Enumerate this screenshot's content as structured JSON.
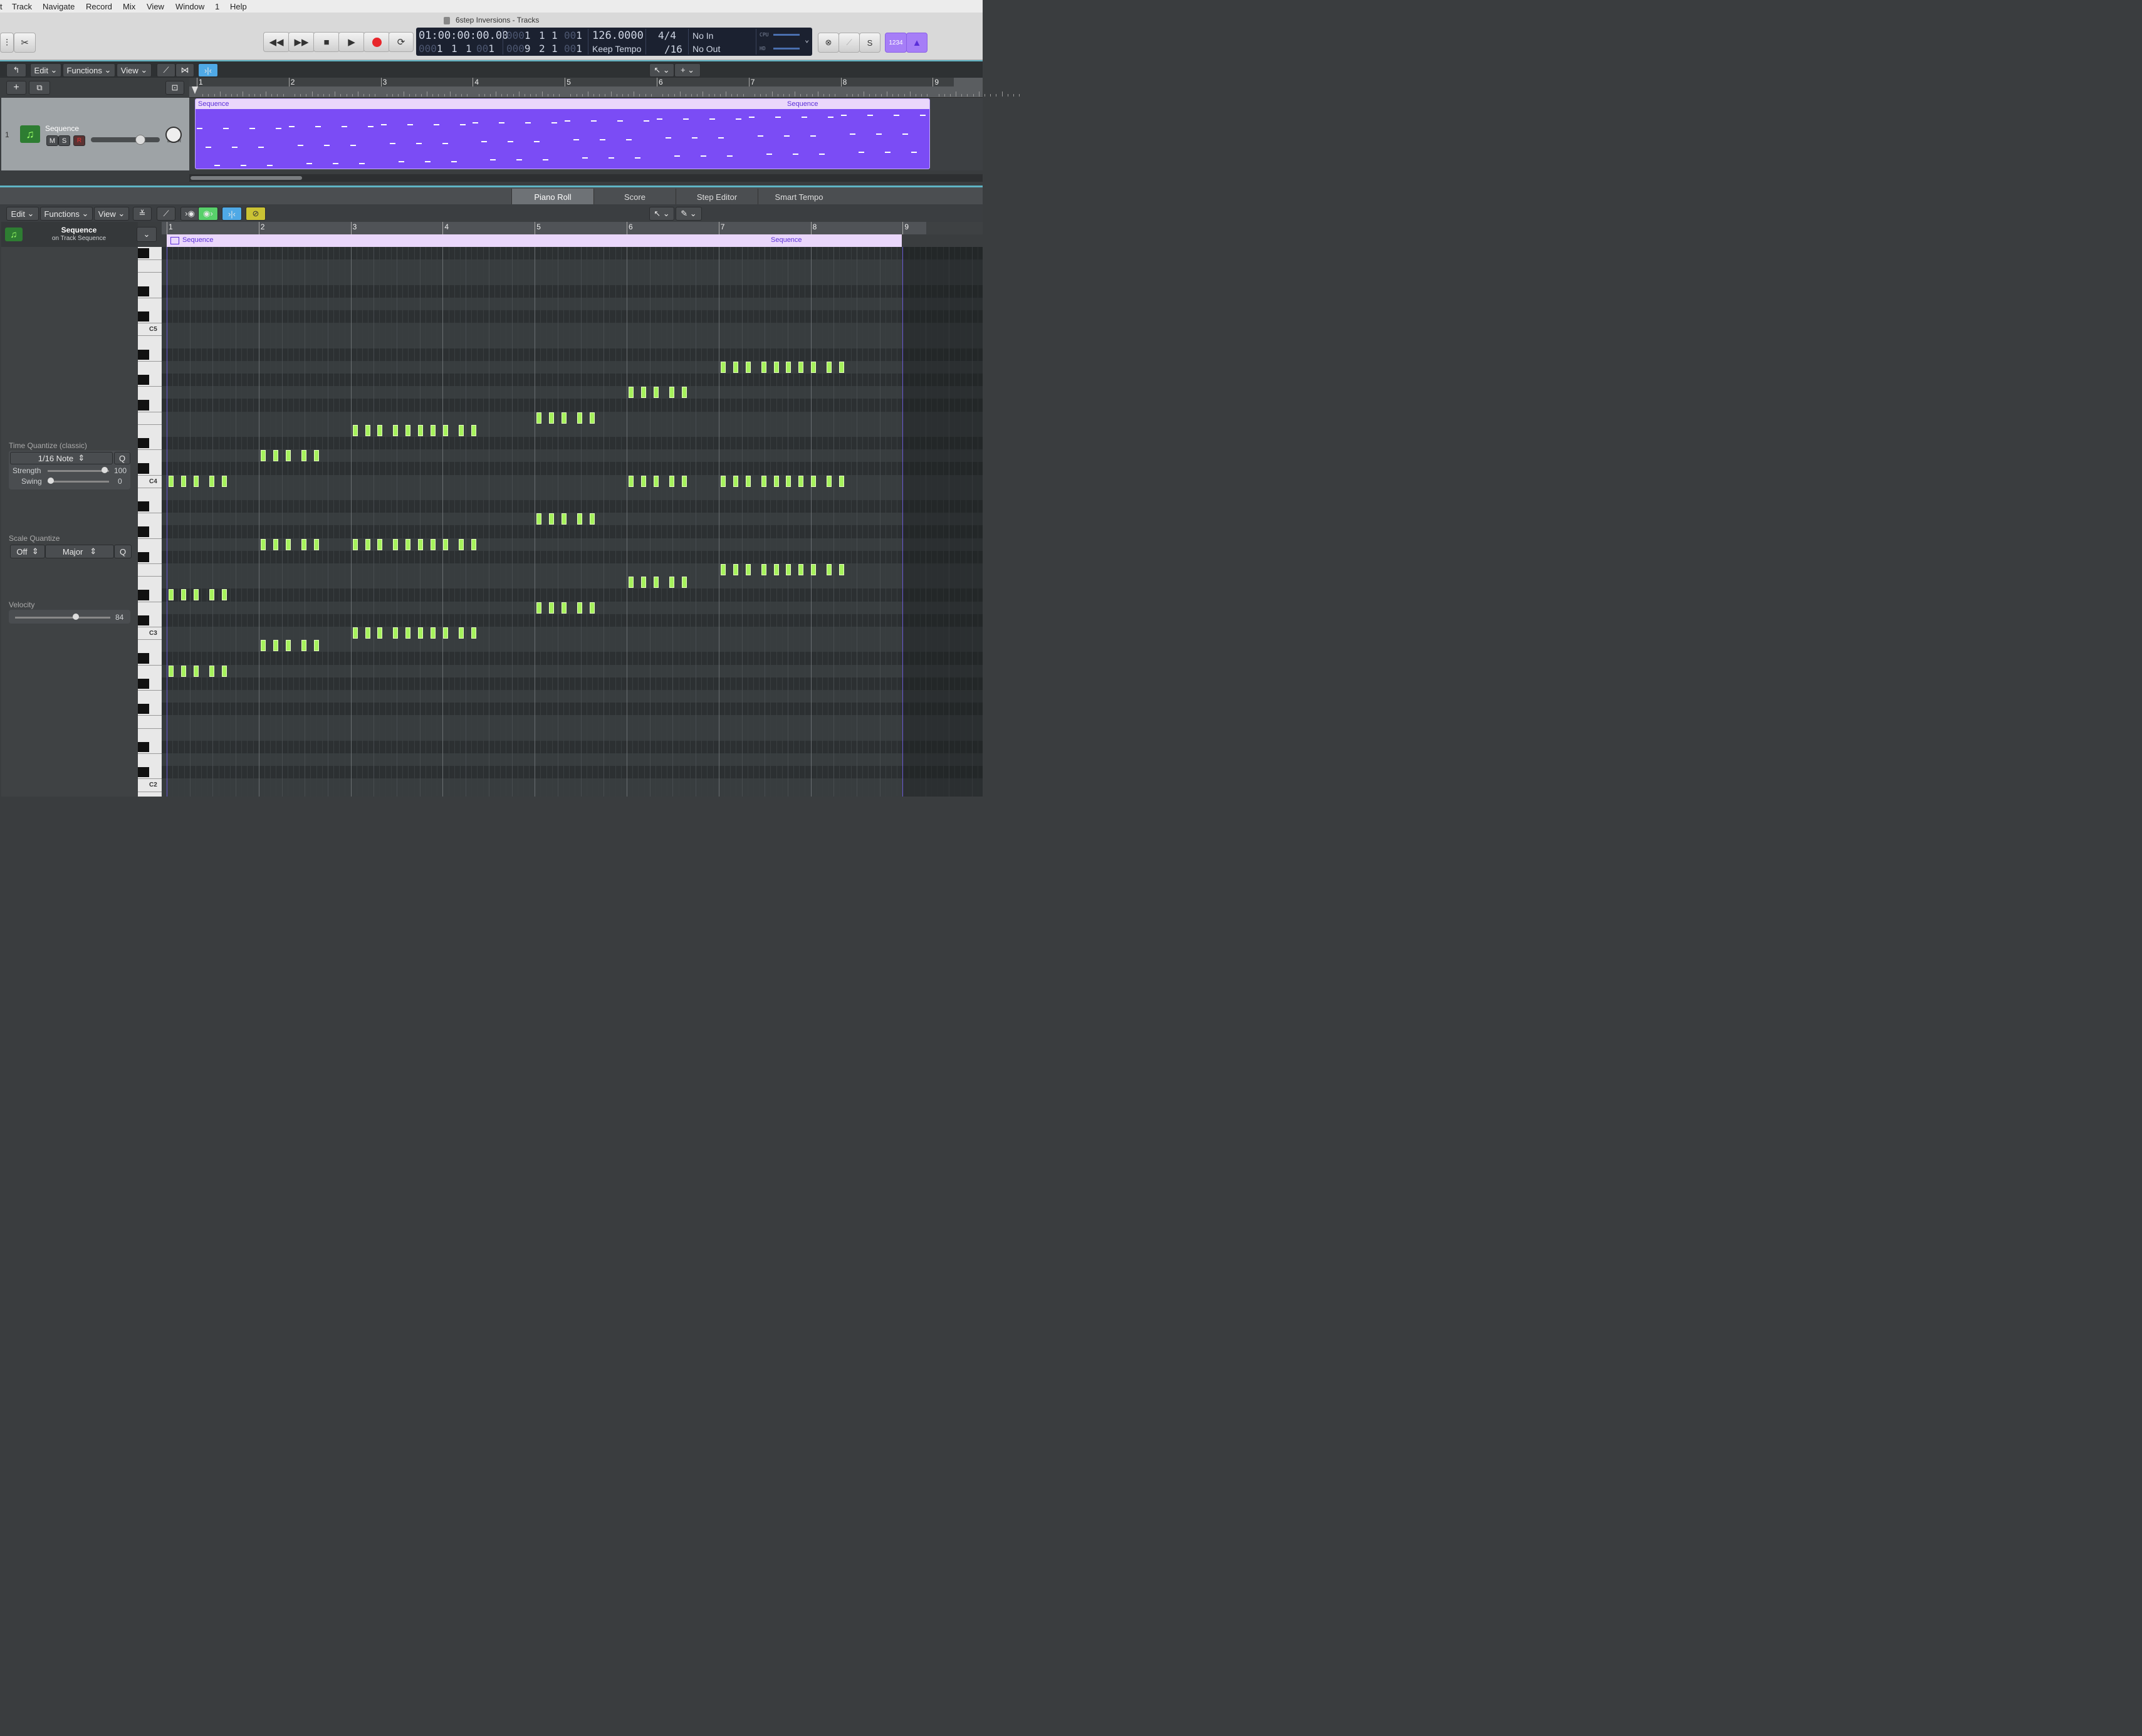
{
  "menubar": {
    "items": [
      "t",
      "Track",
      "Navigate",
      "Record",
      "Mix",
      "View",
      "Window",
      "1",
      "Help"
    ]
  },
  "window": {
    "title": "6step Inversions - Tracks"
  },
  "lcd": {
    "timecode": "01:00:00:00.00",
    "position_bars_dim": "000",
    "position_bars": "1",
    "position_beat": "1",
    "position_div": "1",
    "position_tick_dim": "00",
    "position_tick": "1",
    "lower_bars_dim": "000",
    "lower_bars": "1",
    "lower_beat": "1",
    "lower_div": "1",
    "lower_tick_dim": "00",
    "lower_tick": "1",
    "end_bars_dim": "000",
    "end_bars": "9",
    "end_beat": "2",
    "end_div": "1",
    "end_tick_dim": "00",
    "end_tick": "1",
    "tempo": "126.0000",
    "tempo_mode": "Keep Tempo",
    "signature": "4/4",
    "division": "/16",
    "midi_in": "No In",
    "midi_out": "No Out",
    "cpu_label": "CPU",
    "hd_label": "HD"
  },
  "controlbar": {
    "counter_label": "1234"
  },
  "tracks_toolbar": {
    "edit": "Edit",
    "functions": "Functions",
    "view": "View"
  },
  "track": {
    "number": "1",
    "name": "Sequence",
    "mute": "M",
    "solo": "S",
    "record": "R",
    "pan_l": "L",
    "pan_r": "R"
  },
  "ruler_bars": [
    "1",
    "2",
    "3",
    "4",
    "5",
    "6",
    "7",
    "8",
    "9"
  ],
  "region": {
    "name": "Sequence",
    "name_loop": "Sequence"
  },
  "editor_tabs": [
    "Piano Roll",
    "Score",
    "Step Editor",
    "Smart Tempo"
  ],
  "editor_toolbar": {
    "edit": "Edit",
    "functions": "Functions",
    "view": "View"
  },
  "inspector": {
    "region_name": "Sequence",
    "region_sub": "on Track Sequence",
    "time_quantize_label": "Time Quantize (classic)",
    "time_quantize_value": "1/16 Note",
    "q": "Q",
    "strength_label": "Strength",
    "strength_value": "100",
    "swing_label": "Swing",
    "swing_value": "0",
    "scale_quantize_label": "Scale Quantize",
    "scale_off": "Off",
    "scale_major": "Major",
    "velocity_label": "Velocity",
    "velocity_value": "84"
  },
  "keyboard_labels": [
    "C5",
    "C4",
    "C3",
    "C2"
  ],
  "colors": {
    "accent": "#5fb4c4",
    "region": "#7b4cf5",
    "note": "#a6f25c",
    "record": "#e8262b"
  }
}
